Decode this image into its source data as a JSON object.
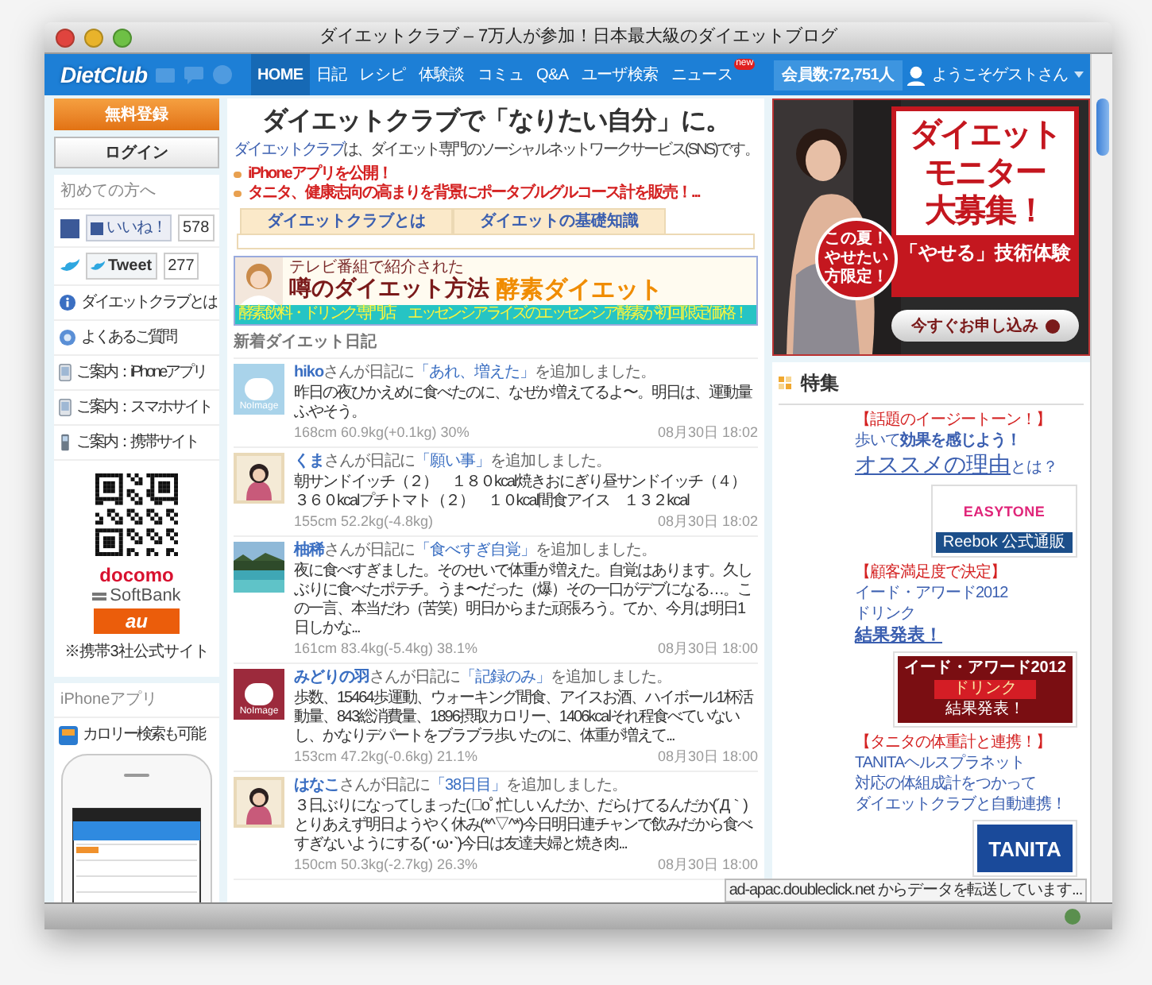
{
  "window": {
    "title": "ダイエットクラブ – 7万人が参加！日本最大級のダイエットブログ"
  },
  "nav": {
    "logo": "DietClub",
    "items": [
      {
        "label": "HOME",
        "selected": true
      },
      {
        "label": "日記",
        "selected": false
      },
      {
        "label": "レシピ",
        "selected": false
      },
      {
        "label": "体験談",
        "selected": false
      },
      {
        "label": "コミュ",
        "selected": false
      },
      {
        "label": "Q&A",
        "selected": false
      },
      {
        "label": "ユーザ検索",
        "selected": false
      },
      {
        "label": "ニュース",
        "selected": false,
        "badge": "new"
      }
    ],
    "member_count": "会員数:72,751人",
    "user": "ようこそゲストさん"
  },
  "sidebar": {
    "register_button": "無料登録",
    "login_button": "ログイン",
    "intro_heading": "初めての方へ",
    "like": {
      "label": "いいね！",
      "count": "578"
    },
    "tweet": {
      "label": "Tweet",
      "count": "277"
    },
    "links": [
      {
        "kind": "info",
        "label": "ダイエットクラブとは"
      },
      {
        "kind": "help",
        "label": "よくあるご質問"
      },
      {
        "kind": "phone",
        "label": "ご案内：iPhoneアプリ"
      },
      {
        "kind": "phone",
        "label": "ご案内：スマホサイト"
      },
      {
        "kind": "mobile",
        "label": "ご案内：携帯サイト"
      }
    ],
    "carriers": {
      "docomo": "docomo",
      "softbank": "SoftBank",
      "au": "au",
      "note": "※携帯3社公式サイト"
    },
    "app_heading": "iPhoneアプリ",
    "app_link": "カロリー検索も可能"
  },
  "main": {
    "headline": "ダイエットクラブで「なりたい自分」に。",
    "intro_link": "ダイエットクラブ",
    "intro_text": "は、ダイエット専門のソーシャルネットワークサービス(SNS)です。",
    "news": [
      "iPhoneアプリを公開！",
      "タニタ、健康志向の高まりを背景にポータブルグルコース計を販売！..."
    ],
    "tabs": [
      {
        "label": "ダイエットクラブとは",
        "selected": false
      },
      {
        "label": "ダイエットの基礎知識",
        "selected": false
      }
    ],
    "banner": {
      "kicker": "テレビ番組で紹介された",
      "title": "噂のダイエット方法",
      "highlight": "酵素ダイエット",
      "footer": "酵素飲料・ドリンク専門店　エッセンシアライズのエッセンシア酵素が初回限定価格！"
    },
    "feed_heading": "新着ダイエット日記",
    "diaries": [
      {
        "kind": "noimage",
        "color": "#a9d3ea",
        "avatar_label": "NoImage",
        "user": "hiko",
        "prefix": "さんが日記に",
        "title": "「あれ、増えた」",
        "suffix": "を追加しました。",
        "body": "昨日の夜ひかえめに食べたのに、なぜか増えてるよ〜。明日は、運動量ふやそう。",
        "stats": "168cm 60.9kg(+0.1kg) 30%",
        "time": "08月30日 18:02"
      },
      {
        "kind": "picture",
        "user": "くま",
        "prefix": "さんが日記に",
        "title": "「願い事」",
        "suffix": "を追加しました。",
        "body_lines": [
          "朝サンドイッチ（２）　１８０kcal焼きおにぎり昼サンドイッチ（４）",
          "３６０kcalプチトマト（２）　１０kcal間食アイス　１３２kcal"
        ],
        "stats": "155cm 52.2kg(-4.8kg)",
        "time": "08月30日 18:02"
      },
      {
        "kind": "picture",
        "user": "柚稀",
        "prefix": "さんが日記に",
        "title": "「食べすぎ自覚」",
        "suffix": "を追加しました。",
        "body": "夜に食べすぎました。そのせいで体重が増えた。自覚はあります。久しぶりに食べたポテチ。うま〜だった（爆）その一口がデブになる…。この一言、本当だわ（苦笑）明日からまた頑張ろう。てか、今月は明日1日しかな...",
        "stats": "161cm 83.4kg(-5.4kg) 38.1%",
        "time": "08月30日 18:00"
      },
      {
        "kind": "noimage",
        "color": "#9c2a3c",
        "avatar_label": "NoImage",
        "user": "みどりの羽",
        "prefix": "さんが日記に",
        "title": "「記録のみ」",
        "suffix": "を追加しました。",
        "body": "歩数、15464歩運動、ウォーキング間食、アイスお酒、ハイボール1杯活動量、843総消費量、1896摂取カロリー、1406kcalそれ程食べていないし、かなりデパートをブラブラ歩いたのに、体重が増えて...",
        "stats": "153cm 47.2kg(-0.6kg) 21.1%",
        "time": "08月30日 18:00"
      },
      {
        "kind": "picture",
        "user": "はなこ",
        "prefix": "さんが日記に",
        "title": "「38日目」",
        "suffix": "を追加しました。",
        "body": "３日ぶりになってしまった(ﾟoﾟ;忙しいんだか、だらけてるんだか(´Д｀)とりあえず明日ようやく休み(*^▽^*)今日明日連チャンで飲みだから食べすぎないようにする(´･ω･`)今日は友達夫婦と焼き肉...",
        "stats": "150cm 50.3kg(-2.7kg) 26.3%",
        "time": "08月30日 18:00"
      }
    ]
  },
  "right": {
    "ad": {
      "badge": "この夏！やせたい方限定！",
      "title_lines": [
        "ダイエット",
        "モニター",
        "大募集！"
      ],
      "subtitle": "「やせる」技術体験",
      "button": "今すぐお申し込み"
    },
    "section_heading": "特集",
    "features": [
      {
        "tag": "【話題のイージートーン！】",
        "lines": [
          "歩いて**効果を感じよう！**"
        ],
        "link": "オススメの理由",
        "link_suffix": "とは？",
        "ad": {
          "kind": "easytone",
          "texts": [
            "EASYTONE",
            "Reebok 公式通販"
          ]
        }
      },
      {
        "tag": "【顧客満足度で決定】",
        "lines": [
          "イード・アワード2012",
          "ドリンク"
        ],
        "link": "結果発表！",
        "ad": {
          "kind": "award",
          "texts": [
            "イード・アワード2012",
            "ドリンク",
            "結果発表！"
          ]
        }
      },
      {
        "tag": "【タニタの体重計と連携！】",
        "lines": [
          "TANITAヘルスプラネット",
          "対応の体組成計をつかって",
          "ダイエットクラブと自動連携！"
        ],
        "ad": {
          "kind": "tanita",
          "texts": [
            "TANITA"
          ]
        }
      }
    ]
  },
  "status": "ad-apac.doubleclick.net からデータを転送しています..."
}
